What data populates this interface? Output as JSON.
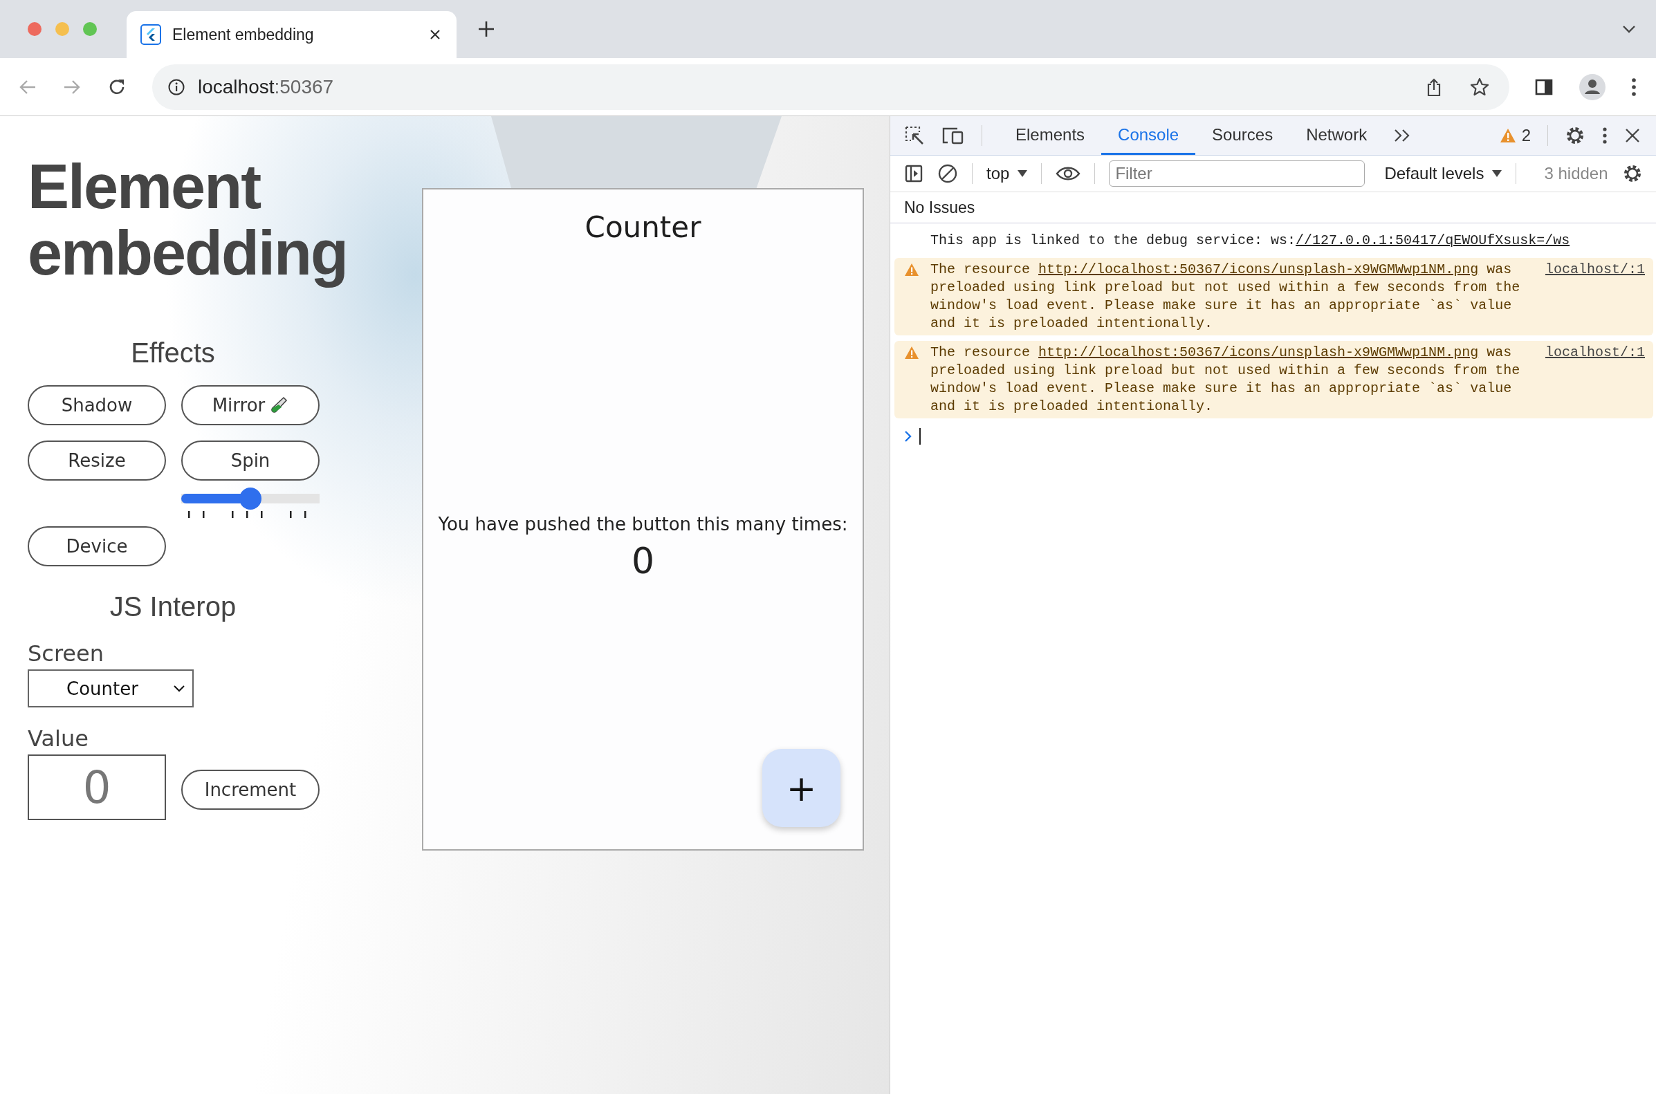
{
  "browser": {
    "tab": {
      "title": "Element embedding",
      "selected": true
    },
    "address": {
      "host": "localhost",
      "port": ":50367"
    }
  },
  "page": {
    "title": "Element embedding",
    "effects": {
      "heading": "Effects",
      "items": [
        {
          "kind": "button",
          "label": "Shadow"
        },
        {
          "kind": "experimental",
          "label": "Mirror"
        },
        {
          "kind": "button",
          "label": "Resize"
        },
        {
          "kind": "button",
          "label": "Spin"
        },
        {
          "kind": "slider",
          "level": 0.5
        },
        {
          "kind": "button",
          "label": "Device"
        }
      ]
    },
    "interop": {
      "heading": "JS Interop",
      "screen_label": "Screen",
      "screen_value": "Counter",
      "value_label": "Value",
      "value": "0",
      "button": "Increment"
    },
    "counter": {
      "title": "Counter",
      "message": "You have pushed the button this many times:",
      "count": "0",
      "fab": "+"
    }
  },
  "devtools": {
    "tabs": [
      {
        "label": "Elements",
        "selected": false
      },
      {
        "label": "Console",
        "selected": true
      },
      {
        "label": "Sources",
        "selected": false
      },
      {
        "label": "Network",
        "selected": false
      }
    ],
    "warnings": "2",
    "context": "top",
    "filter_placeholder": "Filter",
    "levels": "Default levels",
    "hidden": "3 hidden",
    "issues": "No Issues",
    "messages": [
      {
        "kind": "info",
        "text": "This app is linked to the debug service: ws:",
        "link": "//127.0.0.1:50417/qEWOUfXsusk=/ws"
      },
      {
        "kind": "warning",
        "text": "The resource ",
        "link": "http://localhost:50367/icons/unsplash-x9WGMWwp1NM.png",
        "rest": " was preloaded using link preload but not used within a few seconds from the window's load event. Please make sure it has an appropriate `as` value and it is preloaded intentionally.",
        "source": "localhost/:1"
      },
      {
        "kind": "warning",
        "text": "The resource ",
        "link": "http://localhost:50367/icons/unsplash-x9WGMWwp1NM.png",
        "rest": " was preloaded using link preload but not used within a few seconds from the window's load event. Please make sure it has an appropriate `as` value and it is preloaded intentionally.",
        "source": "localhost/:1"
      }
    ]
  }
}
